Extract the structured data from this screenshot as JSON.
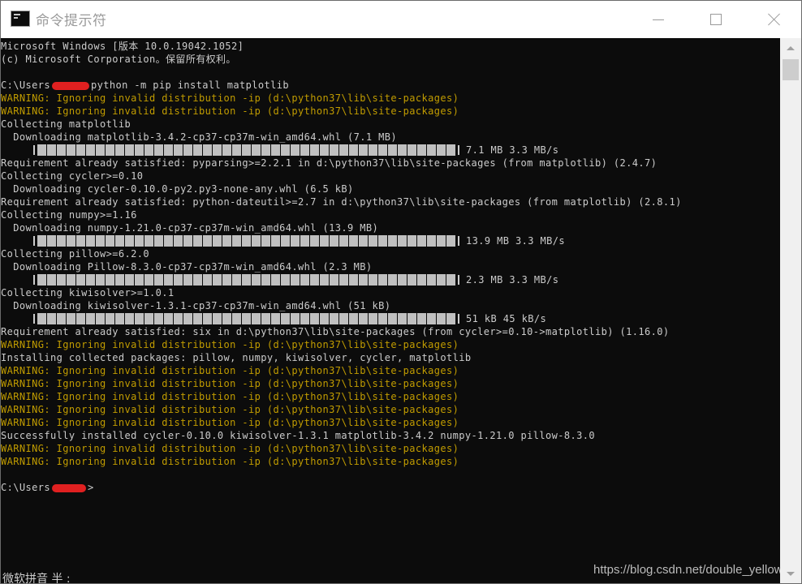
{
  "window": {
    "title": "命令提示符",
    "app_icon": "cmd-icon"
  },
  "colors": {
    "background": "#0c0c0c",
    "text": "#cccccc",
    "warning": "#c19c00",
    "progress": "#c0c0c0",
    "redaction": "#e02020"
  },
  "lines": [
    {
      "type": "text",
      "text": "Microsoft Windows [版本 10.0.19042.1052]"
    },
    {
      "type": "text",
      "text": "(c) Microsoft Corporation。保留所有权利。"
    },
    {
      "type": "blank",
      "text": ""
    },
    {
      "type": "prompt",
      "prefix": "C:\\Users",
      "suffix": "python -m pip install matplotlib"
    },
    {
      "type": "warn",
      "text": "WARNING: Ignoring invalid distribution -ip (d:\\python37\\lib\\site-packages)"
    },
    {
      "type": "warn",
      "text": "WARNING: Ignoring invalid distribution -ip (d:\\python37\\lib\\site-packages)"
    },
    {
      "type": "text",
      "text": "Collecting matplotlib"
    },
    {
      "type": "text",
      "text": "  Downloading matplotlib-3.4.2-cp37-cp37m-win_amd64.whl (7.1 MB)"
    },
    {
      "type": "progress",
      "progress": 1,
      "text": "7.1 MB 3.3 MB/s"
    },
    {
      "type": "text",
      "text": "Requirement already satisfied: pyparsing>=2.2.1 in d:\\python37\\lib\\site-packages (from matplotlib) (2.4.7)"
    },
    {
      "type": "text",
      "text": "Collecting cycler>=0.10"
    },
    {
      "type": "text",
      "text": "  Downloading cycler-0.10.0-py2.py3-none-any.whl (6.5 kB)"
    },
    {
      "type": "text",
      "text": "Requirement already satisfied: python-dateutil>=2.7 in d:\\python37\\lib\\site-packages (from matplotlib) (2.8.1)"
    },
    {
      "type": "text",
      "text": "Collecting numpy>=1.16"
    },
    {
      "type": "text",
      "text": "  Downloading numpy-1.21.0-cp37-cp37m-win_amd64.whl (13.9 MB)"
    },
    {
      "type": "progress",
      "progress": 1,
      "text": "13.9 MB 3.3 MB/s"
    },
    {
      "type": "text",
      "text": "Collecting pillow>=6.2.0"
    },
    {
      "type": "text",
      "text": "  Downloading Pillow-8.3.0-cp37-cp37m-win_amd64.whl (2.3 MB)"
    },
    {
      "type": "progress",
      "progress": 1,
      "text": "2.3 MB 3.3 MB/s"
    },
    {
      "type": "text",
      "text": "Collecting kiwisolver>=1.0.1"
    },
    {
      "type": "text",
      "text": "  Downloading kiwisolver-1.3.1-cp37-cp37m-win_amd64.whl (51 kB)"
    },
    {
      "type": "progress",
      "progress": 1,
      "text": "51 kB 45 kB/s"
    },
    {
      "type": "text",
      "text": "Requirement already satisfied: six in d:\\python37\\lib\\site-packages (from cycler>=0.10->matplotlib) (1.16.0)"
    },
    {
      "type": "warn",
      "text": "WARNING: Ignoring invalid distribution -ip (d:\\python37\\lib\\site-packages)"
    },
    {
      "type": "text",
      "text": "Installing collected packages: pillow, numpy, kiwisolver, cycler, matplotlib"
    },
    {
      "type": "warn",
      "text": "WARNING: Ignoring invalid distribution -ip (d:\\python37\\lib\\site-packages)"
    },
    {
      "type": "warn",
      "text": "WARNING: Ignoring invalid distribution -ip (d:\\python37\\lib\\site-packages)"
    },
    {
      "type": "warn",
      "text": "WARNING: Ignoring invalid distribution -ip (d:\\python37\\lib\\site-packages)"
    },
    {
      "type": "warn",
      "text": "WARNING: Ignoring invalid distribution -ip (d:\\python37\\lib\\site-packages)"
    },
    {
      "type": "warn",
      "text": "WARNING: Ignoring invalid distribution -ip (d:\\python37\\lib\\site-packages)"
    },
    {
      "type": "text",
      "text": "Successfully installed cycler-0.10.0 kiwisolver-1.3.1 matplotlib-3.4.2 numpy-1.21.0 pillow-8.3.0"
    },
    {
      "type": "warn",
      "text": "WARNING: Ignoring invalid distribution -ip (d:\\python37\\lib\\site-packages)"
    },
    {
      "type": "warn",
      "text": "WARNING: Ignoring invalid distribution -ip (d:\\python37\\lib\\site-packages)"
    },
    {
      "type": "blank",
      "text": ""
    },
    {
      "type": "prompt",
      "prefix": "C:\\Users",
      "suffix": ">"
    }
  ],
  "ime_status": "微软拼音 半 :",
  "watermark": "https://blog.csdn.net/double_yellow"
}
